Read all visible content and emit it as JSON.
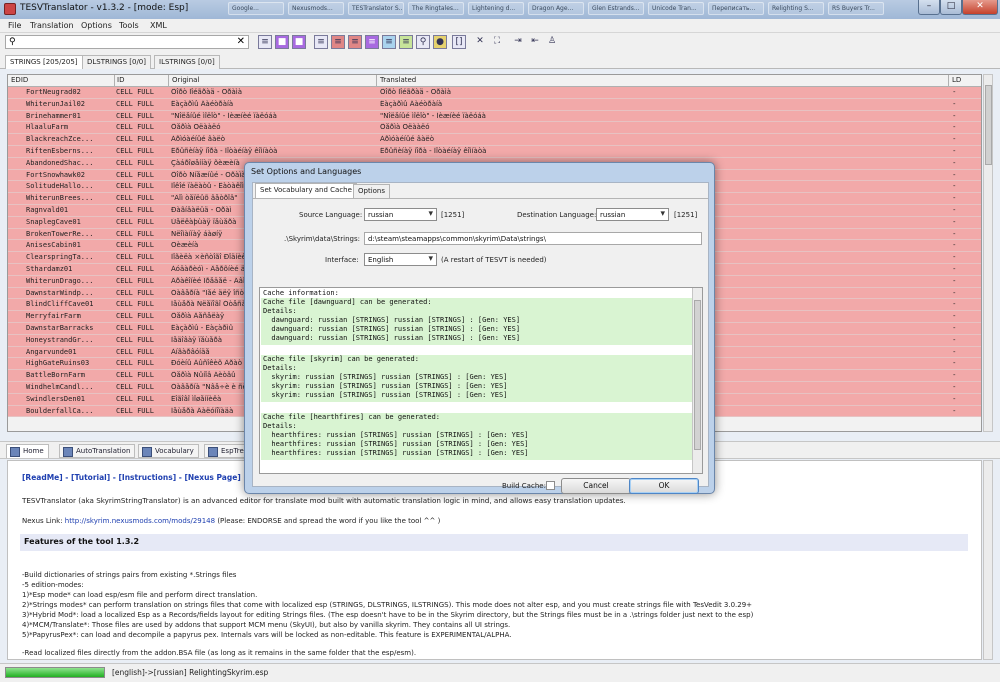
{
  "window": {
    "title": "TESVTranslator - v1.3.2 - [mode: Esp]",
    "background_tabs": [
      "Google...",
      "Nexusmods...",
      "TESTranslator S...",
      "The Ringtales...",
      "Lightening d...",
      "Dragon Age...",
      "Glen Estrands...",
      "Unicode Tran...",
      "Переписать...",
      "Relighting S...",
      "RS Buyers Tr..."
    ]
  },
  "menu": [
    "File",
    "Translation",
    "Options",
    "Tools",
    "XML"
  ],
  "search": {
    "value": "",
    "clear_glyph": "✕"
  },
  "toolbar_icons": [
    "list-icon",
    "purple-square-icon",
    "purple-square-icon",
    "rows-icon",
    "red-rows-icon",
    "red-rows-icon",
    "purple-rows-icon",
    "blue-rows-icon",
    "green-rows-icon",
    "search-icon",
    "bulb-icon",
    "bracket-icon",
    "close-icon",
    "expand-icon",
    "export-icon",
    "import-icon",
    "user-search-icon"
  ],
  "string_tabs": [
    "STRINGS [205/205]",
    "DLSTRINGS [0/0]",
    "ILSTRINGS [0/0]"
  ],
  "grid": {
    "columns": [
      "EDID",
      "ID",
      "Original",
      "Translated",
      "LD"
    ],
    "rows": [
      {
        "edid": "FortNeugrad02",
        "id": "CELL FULL",
        "orig": "Ôîðò Íîéãðàä - Õðàìà",
        "trans": "Ôîðò Íîéãðàä - Õðàìà",
        "ld": "-"
      },
      {
        "edid": "WhiterunJail02",
        "id": "CELL FULL",
        "orig": "Êàçàðìû Âàéòðàíà",
        "trans": "Êàçàðìû Âàéòðàíà",
        "ld": "-"
      },
      {
        "edid": "Brinehammer01",
        "id": "CELL FULL",
        "orig": "\"Ñîëåíûé ìîëîò\" - Íèæíèé ïàëóáà",
        "trans": "\"Ñîëåíûé ìîëîò\" - Íèæíèé ïàëóáà",
        "ld": "-"
      },
      {
        "edid": "HlaaluFarm",
        "id": "CELL FULL",
        "orig": "Ôåðìà Õëààëó",
        "trans": "Ôåðìà Õëààëó",
        "ld": "-"
      },
      {
        "edid": "BlackreachZce...",
        "id": "CELL FULL",
        "orig": "Àðìóàéíûé âàëò",
        "trans": "Àðìóàéíûé âàëò",
        "ld": "-"
      },
      {
        "edid": "RiftenEsberns...",
        "id": "CELL FULL",
        "orig": "Êðûñèíàÿ íîðà - Ïîòàéíàÿ êîìíàòà",
        "trans": "Êðûñèíàÿ íîðà - Ïîòàéíàÿ êîìíàòà",
        "ld": "-"
      },
      {
        "edid": "AbandonedShac...",
        "id": "CELL FULL",
        "orig": "Çàáðîøåííàÿ õèæèíà",
        "trans": "",
        "ld": "-"
      },
      {
        "edid": "FortSnowhawk02",
        "id": "CELL FULL",
        "orig": "Ôîðò Ñíåæíûé - Õðàìà",
        "trans": "",
        "ld": "-"
      },
      {
        "edid": "SolitudeHallo...",
        "id": "CELL FULL",
        "orig": "Ïîêîé ïàëàòû - Êàòàêîìáû",
        "trans": "",
        "ld": "-"
      },
      {
        "edid": "WhiterunBrees...",
        "id": "CELL FULL",
        "orig": "\"Äîì òåïëûõ âåòðîâ\"",
        "trans": "",
        "ld": "-"
      },
      {
        "edid": "Ragnvald01",
        "id": "CELL FULL",
        "orig": "Ðàãíâàëüä - Õðàì",
        "trans": "",
        "ld": "-"
      },
      {
        "edid": "SnaplegCave01",
        "id": "CELL FULL",
        "orig": "Ùåëêàþùàÿ ïåùåðà",
        "trans": "",
        "ld": "-"
      },
      {
        "edid": "BrokenTowerRe...",
        "id": "CELL FULL",
        "orig": "Ñëîìàííàÿ áàøíÿ",
        "trans": "",
        "ld": "-"
      },
      {
        "edid": "AnisesCabin01",
        "id": "CELL FULL",
        "orig": "Õèæèíà",
        "trans": "",
        "ld": "-"
      },
      {
        "edid": "ClearspringTa...",
        "id": "CELL FULL",
        "orig": "Ìîãèëà ×èñòîãî Ðîäíèêà",
        "trans": "",
        "ld": "-"
      },
      {
        "edid": "Sthardamz01",
        "id": "CELL FULL",
        "orig": "Àóäàðèóì - Âåðõíèé äâîð",
        "trans": "",
        "ld": "-"
      },
      {
        "edid": "WhiterunDrago...",
        "id": "CELL FULL",
        "orig": "Äðàêîíèé Ïðåäåë - Äâîð",
        "trans": "",
        "ld": "-"
      },
      {
        "edid": "DawnstarWindp...",
        "id": "CELL FULL",
        "orig": "Òàâåðíà \"Ïåé äëÿ îñòðîòû\"",
        "trans": "",
        "ld": "-"
      },
      {
        "edid": "BlindCliffCave01",
        "id": "CELL FULL",
        "orig": "Ïåùåðà Ñëåïîãî Óòåñà",
        "trans": "",
        "ld": "-"
      },
      {
        "edid": "MerryfairFarm",
        "id": "CELL FULL",
        "orig": "Ôåðìà Âåñåëàÿ",
        "trans": "",
        "ld": "-"
      },
      {
        "edid": "DawnstarBarracks",
        "id": "CELL FULL",
        "orig": "Êàçàðìû - Êàçàðìû",
        "trans": "",
        "ld": "-"
      },
      {
        "edid": "HoneystrandGr...",
        "id": "CELL FULL",
        "orig": "Ìåäîâàÿ ïåùåðà",
        "trans": "",
        "ld": "-"
      },
      {
        "edid": "Angarvunde01",
        "id": "CELL FULL",
        "orig": "Àíãàðâóíäå",
        "trans": "",
        "ld": "-"
      },
      {
        "edid": "HighGateRuins03",
        "id": "CELL FULL",
        "orig": "Ðóèíû Âûñîêèõ Âðàò",
        "trans": "",
        "ld": "-"
      },
      {
        "edid": "BattleBornFarm",
        "id": "CELL FULL",
        "orig": "Ôåðìà Ñûíîâ Áèòâû",
        "trans": "",
        "ld": "-"
      },
      {
        "edid": "WindhelmCandl...",
        "id": "CELL FULL",
        "orig": "Òàâåðíà \"Ñâå÷è è ñëàäêèé\"",
        "trans": "",
        "ld": "-"
      },
      {
        "edid": "SwindlersDen01",
        "id": "CELL FULL",
        "orig": "Ëîãîâî ìîøåííèêà",
        "trans": "",
        "ld": "-"
      },
      {
        "edid": "BoulderfallCa...",
        "id": "CELL FULL",
        "orig": "Ïåùåðà Âàëóíîïàäà",
        "trans": "",
        "ld": "-"
      }
    ]
  },
  "bottom_tabs": [
    "Home",
    "AutoTranslation",
    "Vocabulary",
    "EspTree"
  ],
  "doc": {
    "links": "[ReadMe] - [Tutorial] - [Instructions] - [Nexus Page]",
    "intro": "TESVTranslator (aka SkyrimStringTranslator) is an advanced editor for translate mod built with automatic translation logic in mind, and allows easy translation updates.",
    "nexus_prefix": "Nexus Link: ",
    "nexus_url": "http://skyrim.nexusmods.com/mods/29148",
    "nexus_suffix": " (Please: ENDORSE and spread the word if you like the tool ^^ )",
    "features_title": "Features of the tool 1.3.2",
    "lines": [
      "-Build dictionaries of strings pairs from existing *.Strings files",
      "-5 edition-modes:",
      "1)*Esp mode*  can load esp/esm file and perform direct translation.",
      "2)*Strings modes*  can perform translation on strings files that come with localized esp (STRINGS, DLSTRINGS, ILSTRINGS). This mode does not alter esp, and you must create strings file with TesVedit 3.0.29+",
      "3)*Hybrid Mod*: load a localized Esp as a Records/fields layout for editing Strings files. (The esp doesn't have to be in the Skyrim directory, but the Strings files must be in a .\\strings folder just next to the esp)",
      "4)*MCM/Translate*: Those files are used by addons that support MCM menu (SkyUI), but also by vanilla skyrim. They contains all UI strings.",
      "5)*PapyrusPex*: can load and decompile a papyrus pex. Internals vars will be locked as non-editable. This feature is EXPERIMENTAL/ALPHA.",
      "",
      "-Read localized files directly from the addon.BSA file (as long as it remains in the same folder that the esp/esm)."
    ]
  },
  "status": {
    "progress": 1.0,
    "text": "[english]->[russian] RelightingSkyrim.esp"
  },
  "dialog": {
    "title": "Set Options and Languages",
    "tabs": [
      "Set Vocabulary and Cache",
      "Options"
    ],
    "source_language_label": "Source Language:",
    "source_language": "russian",
    "source_codepage": "[1251]",
    "destination_language_label": "Destination Language:",
    "destination_language": "russian",
    "destination_codepage": "[1251]",
    "strings_path_label": ".\\Skyrim\\data\\Strings:",
    "strings_path": "d:\\steam\\steamapps\\common\\skyrim\\Data\\strings\\",
    "interface_label": "Interface:",
    "interface_value": "English",
    "interface_note": "(A restart of TESVT is needed)",
    "cache_info": "Cache information:",
    "sections": [
      {
        "header": "Cache file [dawnguard] can be generated:",
        "details": "Details:",
        "lines": [
          "  dawnguard: russian [STRINGS] russian [STRINGS] : [Gen: YES]",
          "  dawnguard: russian [STRINGS] russian [STRINGS] : [Gen: YES]",
          "  dawnguard: russian [STRINGS] russian [STRINGS] : [Gen: YES]"
        ]
      },
      {
        "header": "Cache file [skyrim] can be generated:",
        "details": "Details:",
        "lines": [
          "  skyrim: russian [STRINGS] russian [STRINGS] : [Gen: YES]",
          "  skyrim: russian [STRINGS] russian [STRINGS] : [Gen: YES]",
          "  skyrim: russian [STRINGS] russian [STRINGS] : [Gen: YES]"
        ]
      },
      {
        "header": "Cache file [hearthfires] can be generated:",
        "details": "Details:",
        "lines": [
          "  hearthfires: russian [STRINGS] russian [STRINGS] : [Gen: YES]",
          "  hearthfires: russian [STRINGS] russian [STRINGS] : [Gen: YES]",
          "  hearthfires: russian [STRINGS] russian [STRINGS] : [Gen: YES]"
        ]
      }
    ],
    "build_cache_label": "Build Cache:",
    "cancel": "Cancel",
    "ok": "OK"
  },
  "colors": {
    "row_untranslated": "#f2a9a9",
    "cache_ok": "#d9f4d2",
    "link": "#1e3fb0"
  }
}
